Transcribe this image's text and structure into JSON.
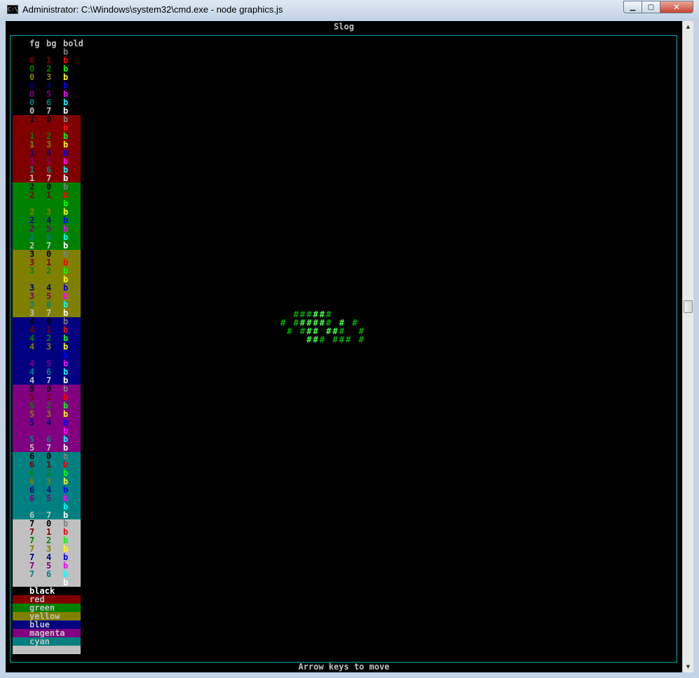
{
  "window": {
    "title": "Administrator: C:\\Windows\\system32\\cmd.exe - node  graphics.js",
    "icon": "cmd-icon",
    "controls": {
      "minimize": "▁",
      "maximize": "▢",
      "close": "✕"
    }
  },
  "console": {
    "title": "Slog",
    "footer": "Arrow keys to move",
    "header": {
      "fg": "fg",
      "bg": "bg",
      "bold": "bold",
      "color": "#c0c0c0"
    },
    "bold_char": "b"
  },
  "palette_dark": [
    "#000000",
    "#800000",
    "#008000",
    "#808000",
    "#000080",
    "#800080",
    "#008080",
    "#c0c0c0"
  ],
  "palette_bright": [
    "#808080",
    "#ff0000",
    "#00ff00",
    "#ffff00",
    "#0000ff",
    "#ff00ff",
    "#00ffff",
    "#ffffff"
  ],
  "color_names": [
    "black",
    "red",
    "green",
    "yellow",
    "blue",
    "magenta",
    "cyan",
    ""
  ],
  "sprite": {
    "color": "#00aa00",
    "bright_color": "#44ff44",
    "rows": [
      {
        "cells": [
          [
            2,
            "#",
            "d"
          ],
          [
            3,
            "#",
            "d"
          ],
          [
            4,
            "#",
            "d"
          ],
          [
            5,
            "#",
            "b"
          ],
          [
            6,
            "#",
            "b"
          ],
          [
            7,
            "#",
            "d"
          ]
        ]
      },
      {
        "cells": [
          [
            0,
            "#",
            "d"
          ],
          [
            2,
            "#",
            "d"
          ],
          [
            3,
            "#",
            "b"
          ],
          [
            4,
            "#",
            "b"
          ],
          [
            5,
            "#",
            "b"
          ],
          [
            6,
            "#",
            "b"
          ],
          [
            7,
            "#",
            "d"
          ],
          [
            9,
            "#",
            "b"
          ],
          [
            11,
            "#",
            "d"
          ]
        ]
      },
      {
        "cells": [
          [
            1,
            "#",
            "d"
          ],
          [
            3,
            "#",
            "d"
          ],
          [
            4,
            "#",
            "b"
          ],
          [
            5,
            "#",
            "b"
          ],
          [
            7,
            "#",
            "b"
          ],
          [
            8,
            "#",
            "b"
          ],
          [
            9,
            "#",
            "d"
          ],
          [
            12,
            "#",
            "d"
          ]
        ]
      },
      {
        "cells": [
          [
            4,
            "#",
            "b"
          ],
          [
            5,
            "#",
            "b"
          ],
          [
            6,
            "#",
            "d"
          ],
          [
            8,
            "#",
            "d"
          ],
          [
            9,
            "#",
            "d"
          ],
          [
            10,
            "#",
            "d"
          ],
          [
            12,
            "#",
            "d"
          ]
        ]
      }
    ]
  }
}
